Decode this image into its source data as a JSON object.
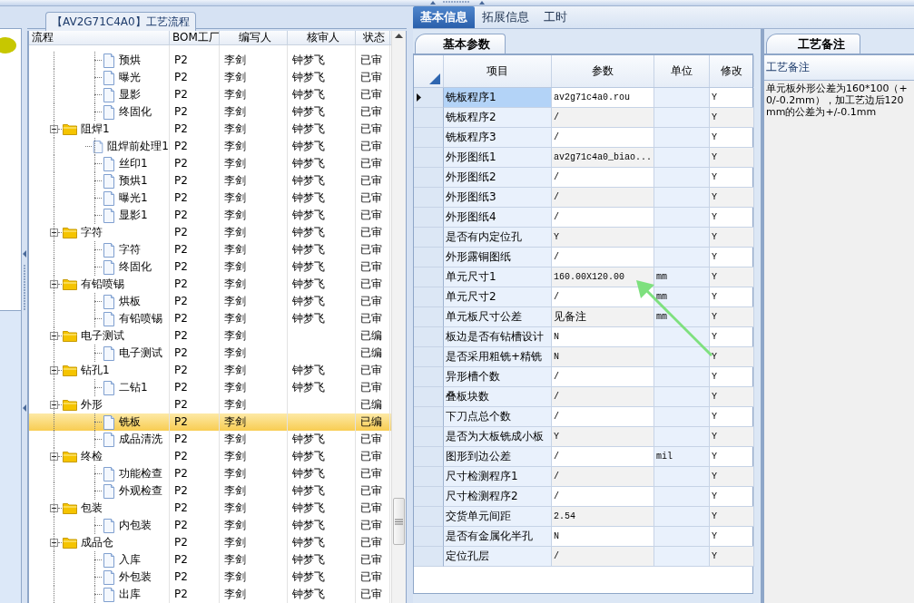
{
  "flow_panel": {
    "tab": "【AV2G71C4A0】工艺流程",
    "columns": [
      "流程",
      "BOM工厂",
      "编写人",
      "核审人",
      "状态"
    ],
    "nodes": [
      {
        "children": [
          {
            "label": "预烘",
            "bom": "P2",
            "writer": "李剑",
            "reviewer": "钟梦飞",
            "status": "已审",
            "selected": false
          },
          {
            "label": "曝光",
            "bom": "P2",
            "writer": "李剑",
            "reviewer": "钟梦飞",
            "status": "已审",
            "selected": false
          },
          {
            "label": "显影",
            "bom": "P2",
            "writer": "李剑",
            "reviewer": "钟梦飞",
            "status": "已审",
            "selected": false
          },
          {
            "label": "终固化",
            "bom": "P2",
            "writer": "李剑",
            "reviewer": "钟梦飞",
            "status": "已审",
            "selected": false
          }
        ]
      },
      {
        "label": "阻焊1",
        "bom": "P2",
        "writer": "李剑",
        "reviewer": "钟梦飞",
        "status": "已审",
        "selected": false,
        "expanded": true,
        "children": [
          {
            "label": "阻焊前处理1",
            "bom": "P2",
            "writer": "李剑",
            "reviewer": "钟梦飞",
            "status": "已审",
            "selected": false
          },
          {
            "label": "丝印1",
            "bom": "P2",
            "writer": "李剑",
            "reviewer": "钟梦飞",
            "status": "已审",
            "selected": false
          },
          {
            "label": "预烘1",
            "bom": "P2",
            "writer": "李剑",
            "reviewer": "钟梦飞",
            "status": "已审",
            "selected": false
          },
          {
            "label": "曝光1",
            "bom": "P2",
            "writer": "李剑",
            "reviewer": "钟梦飞",
            "status": "已审",
            "selected": false
          },
          {
            "label": "显影1",
            "bom": "P2",
            "writer": "李剑",
            "reviewer": "钟梦飞",
            "status": "已审",
            "selected": false
          }
        ]
      },
      {
        "label": "字符",
        "bom": "P2",
        "writer": "李剑",
        "reviewer": "钟梦飞",
        "status": "已审",
        "selected": false,
        "expanded": true,
        "children": [
          {
            "label": "字符",
            "bom": "P2",
            "writer": "李剑",
            "reviewer": "钟梦飞",
            "status": "已审",
            "selected": false
          },
          {
            "label": "终固化",
            "bom": "P2",
            "writer": "李剑",
            "reviewer": "钟梦飞",
            "status": "已审",
            "selected": false
          }
        ]
      },
      {
        "label": "有铅喷锡",
        "bom": "P2",
        "writer": "李剑",
        "reviewer": "钟梦飞",
        "status": "已审",
        "selected": false,
        "expanded": true,
        "children": [
          {
            "label": "烘板",
            "bom": "P2",
            "writer": "李剑",
            "reviewer": "钟梦飞",
            "status": "已审",
            "selected": false
          },
          {
            "label": "有铅喷锡",
            "bom": "P2",
            "writer": "李剑",
            "reviewer": "钟梦飞",
            "status": "已审",
            "selected": false
          }
        ]
      },
      {
        "label": "电子测试",
        "bom": "P2",
        "writer": "李剑",
        "status": "已编",
        "selected": false,
        "expanded": true,
        "children": [
          {
            "label": "电子测试",
            "bom": "P2",
            "writer": "李剑",
            "status": "已编",
            "selected": false
          }
        ]
      },
      {
        "label": "钻孔1",
        "bom": "P2",
        "writer": "李剑",
        "reviewer": "钟梦飞",
        "status": "已审",
        "selected": false,
        "expanded": true,
        "children": [
          {
            "label": "二钻1",
            "bom": "P2",
            "writer": "李剑",
            "reviewer": "钟梦飞",
            "status": "已审",
            "selected": false
          }
        ]
      },
      {
        "label": "外形",
        "bom": "P2",
        "writer": "李剑",
        "status": "已编",
        "selected": false,
        "expanded": true,
        "children": [
          {
            "label": "铣板",
            "bom": "P2",
            "writer": "李剑",
            "status": "已编",
            "selected": true
          },
          {
            "label": "成品清洗",
            "bom": "P2",
            "writer": "李剑",
            "reviewer": "钟梦飞",
            "status": "已审",
            "selected": false
          }
        ]
      },
      {
        "label": "终检",
        "bom": "P2",
        "writer": "李剑",
        "reviewer": "钟梦飞",
        "status": "已审",
        "selected": false,
        "expanded": true,
        "children": [
          {
            "label": "功能检查",
            "bom": "P2",
            "writer": "李剑",
            "reviewer": "钟梦飞",
            "status": "已审",
            "selected": false
          },
          {
            "label": "外观检查",
            "bom": "P2",
            "writer": "李剑",
            "reviewer": "钟梦飞",
            "status": "已审",
            "selected": false
          }
        ]
      },
      {
        "label": "包装",
        "bom": "P2",
        "writer": "李剑",
        "reviewer": "钟梦飞",
        "status": "已审",
        "selected": false,
        "expanded": true,
        "children": [
          {
            "label": "内包装",
            "bom": "P2",
            "writer": "李剑",
            "reviewer": "钟梦飞",
            "status": "已审",
            "selected": false
          }
        ]
      },
      {
        "label": "成品仓",
        "bom": "P2",
        "writer": "李剑",
        "reviewer": "钟梦飞",
        "status": "已审",
        "selected": false,
        "expanded": true,
        "children": [
          {
            "label": "入库",
            "bom": "P2",
            "writer": "李剑",
            "reviewer": "钟梦飞",
            "status": "已审",
            "selected": false
          },
          {
            "label": "外包装",
            "bom": "P2",
            "writer": "李剑",
            "reviewer": "钟梦飞",
            "status": "已审",
            "selected": false
          },
          {
            "label": "出库",
            "bom": "P2",
            "writer": "李剑",
            "reviewer": "钟梦飞",
            "status": "已审",
            "selected": false
          }
        ]
      }
    ]
  },
  "detail_tabs": [
    {
      "label": "基本信息",
      "selected": true
    },
    {
      "label": "拓展信息",
      "selected": false
    },
    {
      "label": "工时",
      "selected": false
    }
  ],
  "param_tab": {
    "label": "基本参数"
  },
  "param_grid": {
    "columns": [
      "项目",
      "参数",
      "单位",
      "修改"
    ],
    "rows": [
      {
        "item": "铣板程序1",
        "value": "av2g71c4a0.rou",
        "modify": "Y",
        "selected": true
      },
      {
        "item": "铣板程序2",
        "value": "/",
        "modify": "Y",
        "selected": false
      },
      {
        "item": "铣板程序3",
        "value": "/",
        "modify": "Y",
        "selected": false
      },
      {
        "item": "外形图纸1",
        "value": "av2g71c4a0_biao...",
        "modify": "Y",
        "selected": false
      },
      {
        "item": "外形图纸2",
        "value": "/",
        "modify": "Y",
        "selected": false
      },
      {
        "item": "外形图纸3",
        "value": "/",
        "modify": "Y",
        "selected": false
      },
      {
        "item": "外形图纸4",
        "value": "/",
        "modify": "Y",
        "selected": false
      },
      {
        "item": "是否有内定位孔",
        "value": "Y",
        "modify": "Y",
        "selected": false
      },
      {
        "item": "外形露铜图纸",
        "value": "/",
        "modify": "Y",
        "selected": false
      },
      {
        "item": "单元尺寸1",
        "value": "160.00X120.00",
        "unit": "mm",
        "modify": "Y",
        "selected": false
      },
      {
        "item": "单元尺寸2",
        "value": "/",
        "unit": "mm",
        "modify": "Y",
        "selected": false
      },
      {
        "item": "单元板尺寸公差",
        "value": "见备注",
        "unit": "mm",
        "modify": "Y",
        "selected": false
      },
      {
        "item": "板边是否有钻槽设计",
        "value": "N",
        "modify": "Y",
        "selected": false
      },
      {
        "item": "是否采用粗铣+精铣",
        "value": "N",
        "modify": "Y",
        "selected": false
      },
      {
        "item": "异形槽个数",
        "value": "/",
        "modify": "Y",
        "selected": false
      },
      {
        "item": "叠板块数",
        "value": "/",
        "modify": "Y",
        "selected": false
      },
      {
        "item": "下刀点总个数",
        "value": "/",
        "modify": "Y",
        "selected": false
      },
      {
        "item": "是否为大板铣成小板",
        "value": "Y",
        "modify": "Y",
        "selected": false
      },
      {
        "item": "图形到边公差",
        "value": "/",
        "unit": "mil",
        "modify": "Y",
        "selected": false
      },
      {
        "item": "尺寸检测程序1",
        "value": "/",
        "modify": "Y",
        "selected": false
      },
      {
        "item": "尺寸检测程序2",
        "value": "/",
        "modify": "Y",
        "selected": false
      },
      {
        "item": "交货单元间距",
        "value": "2.54",
        "modify": "Y",
        "selected": false
      },
      {
        "item": "是否有金属化半孔",
        "value": "N",
        "modify": "Y",
        "selected": false
      },
      {
        "item": "定位孔层",
        "value": "/",
        "modify": "Y",
        "selected": false
      }
    ]
  },
  "note_panel": {
    "tab": "工艺备注",
    "header": "工艺备注",
    "text": "单元板外形公差为160*100（+0/-0.2mm），加工艺边后120mm的公差为+/-0.1mm"
  }
}
